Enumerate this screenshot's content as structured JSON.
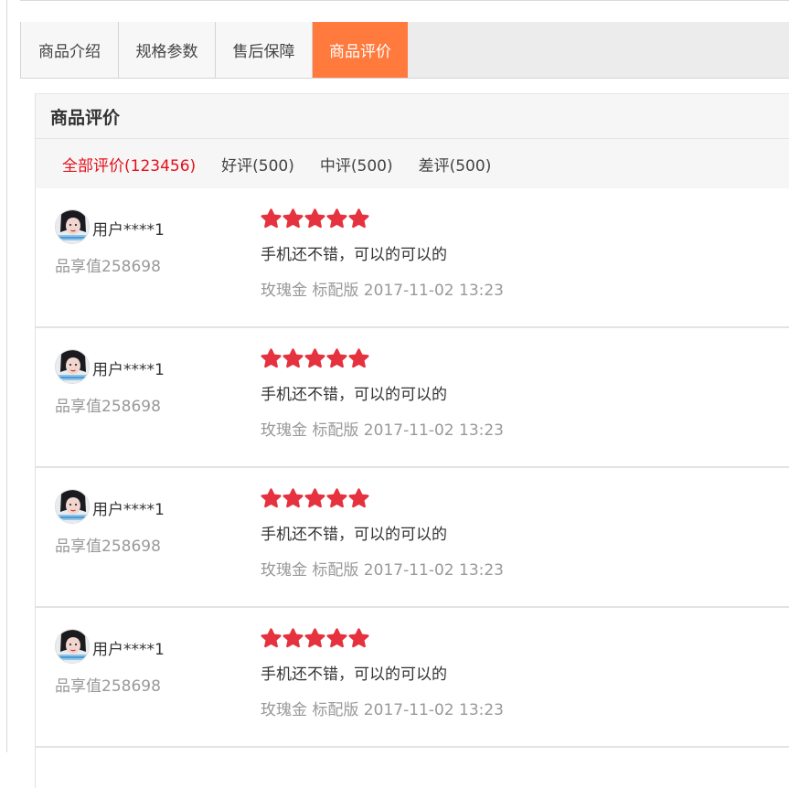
{
  "tabs": [
    {
      "label": "商品介绍",
      "active": false
    },
    {
      "label": "规格参数",
      "active": false
    },
    {
      "label": "售后保障",
      "active": false
    },
    {
      "label": "商品评价",
      "active": true
    }
  ],
  "panel": {
    "title": "商品评价",
    "filters": [
      {
        "label": "全部评价(123456)",
        "active": true
      },
      {
        "label": "好评(500)",
        "active": false
      },
      {
        "label": "中评(500)",
        "active": false
      },
      {
        "label": "差评(500)",
        "active": false
      }
    ]
  },
  "reviews": [
    {
      "user": "用户****1",
      "points": "品享值258698",
      "rating": 5,
      "content": "手机还不错，可以的可以的",
      "meta": "玫瑰金 标配版 2017-11-02 13:23"
    },
    {
      "user": "用户****1",
      "points": "品享值258698",
      "rating": 5,
      "content": "手机还不错，可以的可以的",
      "meta": "玫瑰金 标配版 2017-11-02 13:23"
    },
    {
      "user": "用户****1",
      "points": "品享值258698",
      "rating": 5,
      "content": "手机还不错，可以的可以的",
      "meta": "玫瑰金 标配版 2017-11-02 13:23"
    },
    {
      "user": "用户****1",
      "points": "品享值258698",
      "rating": 5,
      "content": "手机还不错，可以的可以的",
      "meta": "玫瑰金 标配版 2017-11-02 13:23"
    }
  ],
  "colors": {
    "active_tab": "#ff7a3c",
    "active_filter": "#e4101a",
    "star": "#e5323e"
  },
  "icons": {
    "star": "star-icon",
    "avatar": "user-avatar"
  }
}
